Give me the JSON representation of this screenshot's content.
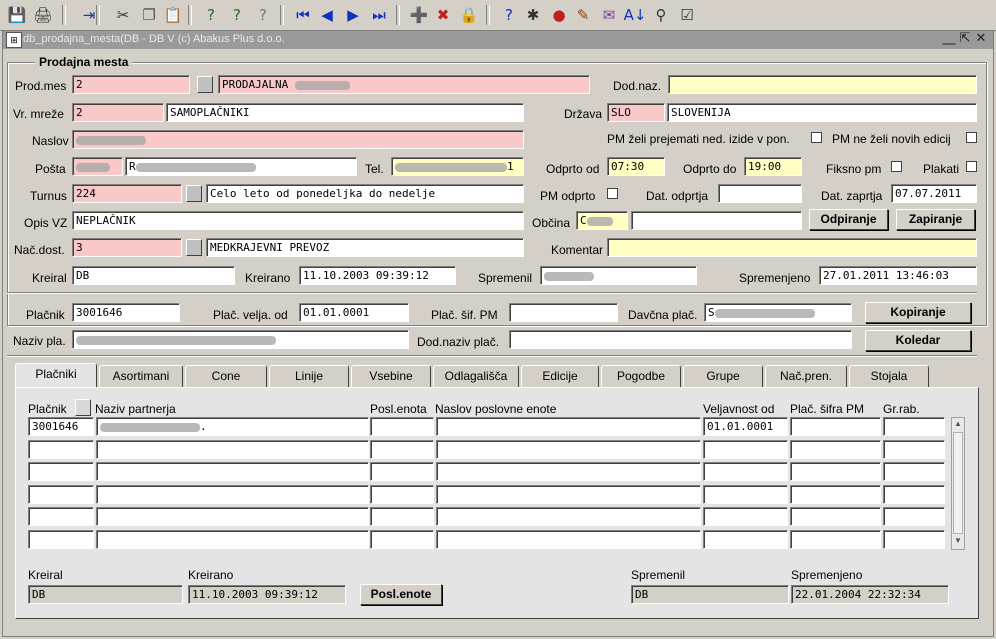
{
  "toolbar": {
    "icons": [
      "save-icon",
      "print-icon",
      "exit-icon",
      "cut-icon",
      "copy-icon",
      "paste-icon",
      "query-icon",
      "execute-query-icon",
      "cancel-query-icon",
      "first-record-icon",
      "previous-record-icon",
      "next-record-icon",
      "last-record-icon",
      "insert-record-icon",
      "delete-record-icon",
      "lock-record-icon",
      "help-icon",
      "debug-icon",
      "erase-icon",
      "book-icon",
      "edit-icon",
      "sort-icon",
      "filter-icon",
      "note-icon"
    ],
    "glyphs": [
      "💾",
      "🖨",
      "⇥",
      "✂",
      "❐",
      "📋",
      "?",
      "?",
      "?",
      "⏮",
      "◀",
      "▶",
      "⏭",
      "➕",
      "✖",
      "🔒",
      "?",
      "✱",
      "●",
      "✎",
      "✉",
      "A↓",
      "⚲",
      "☑"
    ]
  },
  "window": {
    "title": "db_prodajna_mesta(DB         - DB V (c) Abakus Plus d.o.o.",
    "minimize": "⎽",
    "restore": "⇱",
    "close": "✕"
  },
  "section": {
    "title": "Prodajna mesta"
  },
  "form": {
    "prod_mes_label": "Prod.mes",
    "prod_mes_value": "2",
    "prod_mes_name": "PRODAJALNA",
    "dod_naz_label": "Dod.naz.",
    "vr_mreze_label": "Vr. mreže",
    "vr_mreze_value": "2",
    "vr_mreze_name": "SAMOPLAČNIKI",
    "drzava_label": "Država",
    "drzava_code": "SLO",
    "drzava_name": "SLOVENIJA",
    "naslov_label": "Naslov",
    "pm_prejemati_label": "PM želi prejemati ned. izide v pon.",
    "pm_ne_zeli_label": "PM ne želi novih edicij",
    "posta_label": "Pošta",
    "posta_name_prefix": "R",
    "tel_label": "Tel.",
    "tel_suffix": "1",
    "odprto_od_label": "Odprto od",
    "odprto_od_value": "07:30",
    "odprto_do_label": "Odprto do",
    "odprto_do_value": "19:00",
    "fiksno_pm_label": "Fiksno pm",
    "plakati_label": "Plakati",
    "turnus_label": "Turnus",
    "turnus_value": "224",
    "turnus_name": "Celo leto od ponedeljka do nedelje",
    "pm_odprto_label": "PM odprto",
    "dat_odprtja_label": "Dat. odprtja",
    "dat_zaprtja_label": "Dat. zaprtja",
    "dat_zaprtja_value": "07.07.2011",
    "opis_vz_label": "Opis VZ",
    "opis_vz_value": "NEPLAČNIK",
    "obcina_label": "Občina",
    "obcina_prefix": "C",
    "odpiranje_label": "Odpiranje",
    "zapiranje_label": "Zapiranje",
    "nac_dost_label": "Nač.dost.",
    "nac_dost_value": "3",
    "nac_dost_name": "MEDKRAJEVNI PREVOZ",
    "komentar_label": "Komentar",
    "kreiral_label": "Kreiral",
    "kreiral_value": "DB",
    "kreirano_label": "Kreirano",
    "kreirano_value": "11.10.2003 09:39:12",
    "spremenil_label": "Spremenil",
    "spremenjeno_label": "Spremenjeno",
    "spremenjeno_value": "27.01.2011 13:46:03"
  },
  "payer": {
    "placnik_label": "Plačnik",
    "placnik_value": "3001646",
    "plac_velja_label": "Plač. velja. od",
    "plac_velja_value": "01.01.0001",
    "plac_sif_label": "Plač. šif. PM",
    "davcna_label": "Davčna plač.",
    "davcna_prefix": "S",
    "kopiranje_label": "Kopiranje",
    "naziv_label": "Naziv pla.",
    "dod_naziv_label": "Dod.naziv plač.",
    "koledar_label": "Koledar"
  },
  "tabs": [
    "Plačniki",
    "Asortimani",
    "Cone",
    "Linije",
    "Vsebine",
    "Odlagališča",
    "Edicije",
    "Pogodbe",
    "Grupe",
    "Nač.pren.",
    "Stojala"
  ],
  "grid": {
    "headers": [
      "Plačnik",
      "Naziv partnerja",
      "Posl.enota",
      "Naslov poslovne enote",
      "Veljavnost od",
      "Plač. šifra PM",
      "Gr.rab."
    ],
    "row1": {
      "placnik": "3001646",
      "naziv_suffix": ".",
      "veljavnost": "01.01.0001"
    },
    "footer": {
      "kreiral_label": "Kreiral",
      "kreiral_value": "DB",
      "kreirano_label": "Kreirano",
      "kreirano_value": "11.10.2003 09:39:12",
      "posl_enote_label": "Posl.enote",
      "spremenil_label": "Spremenil",
      "spremenil_value": "DB",
      "spremenjeno_label": "Spremenjeno",
      "spremenjeno_value": "22.01.2004 22:32:34"
    }
  }
}
